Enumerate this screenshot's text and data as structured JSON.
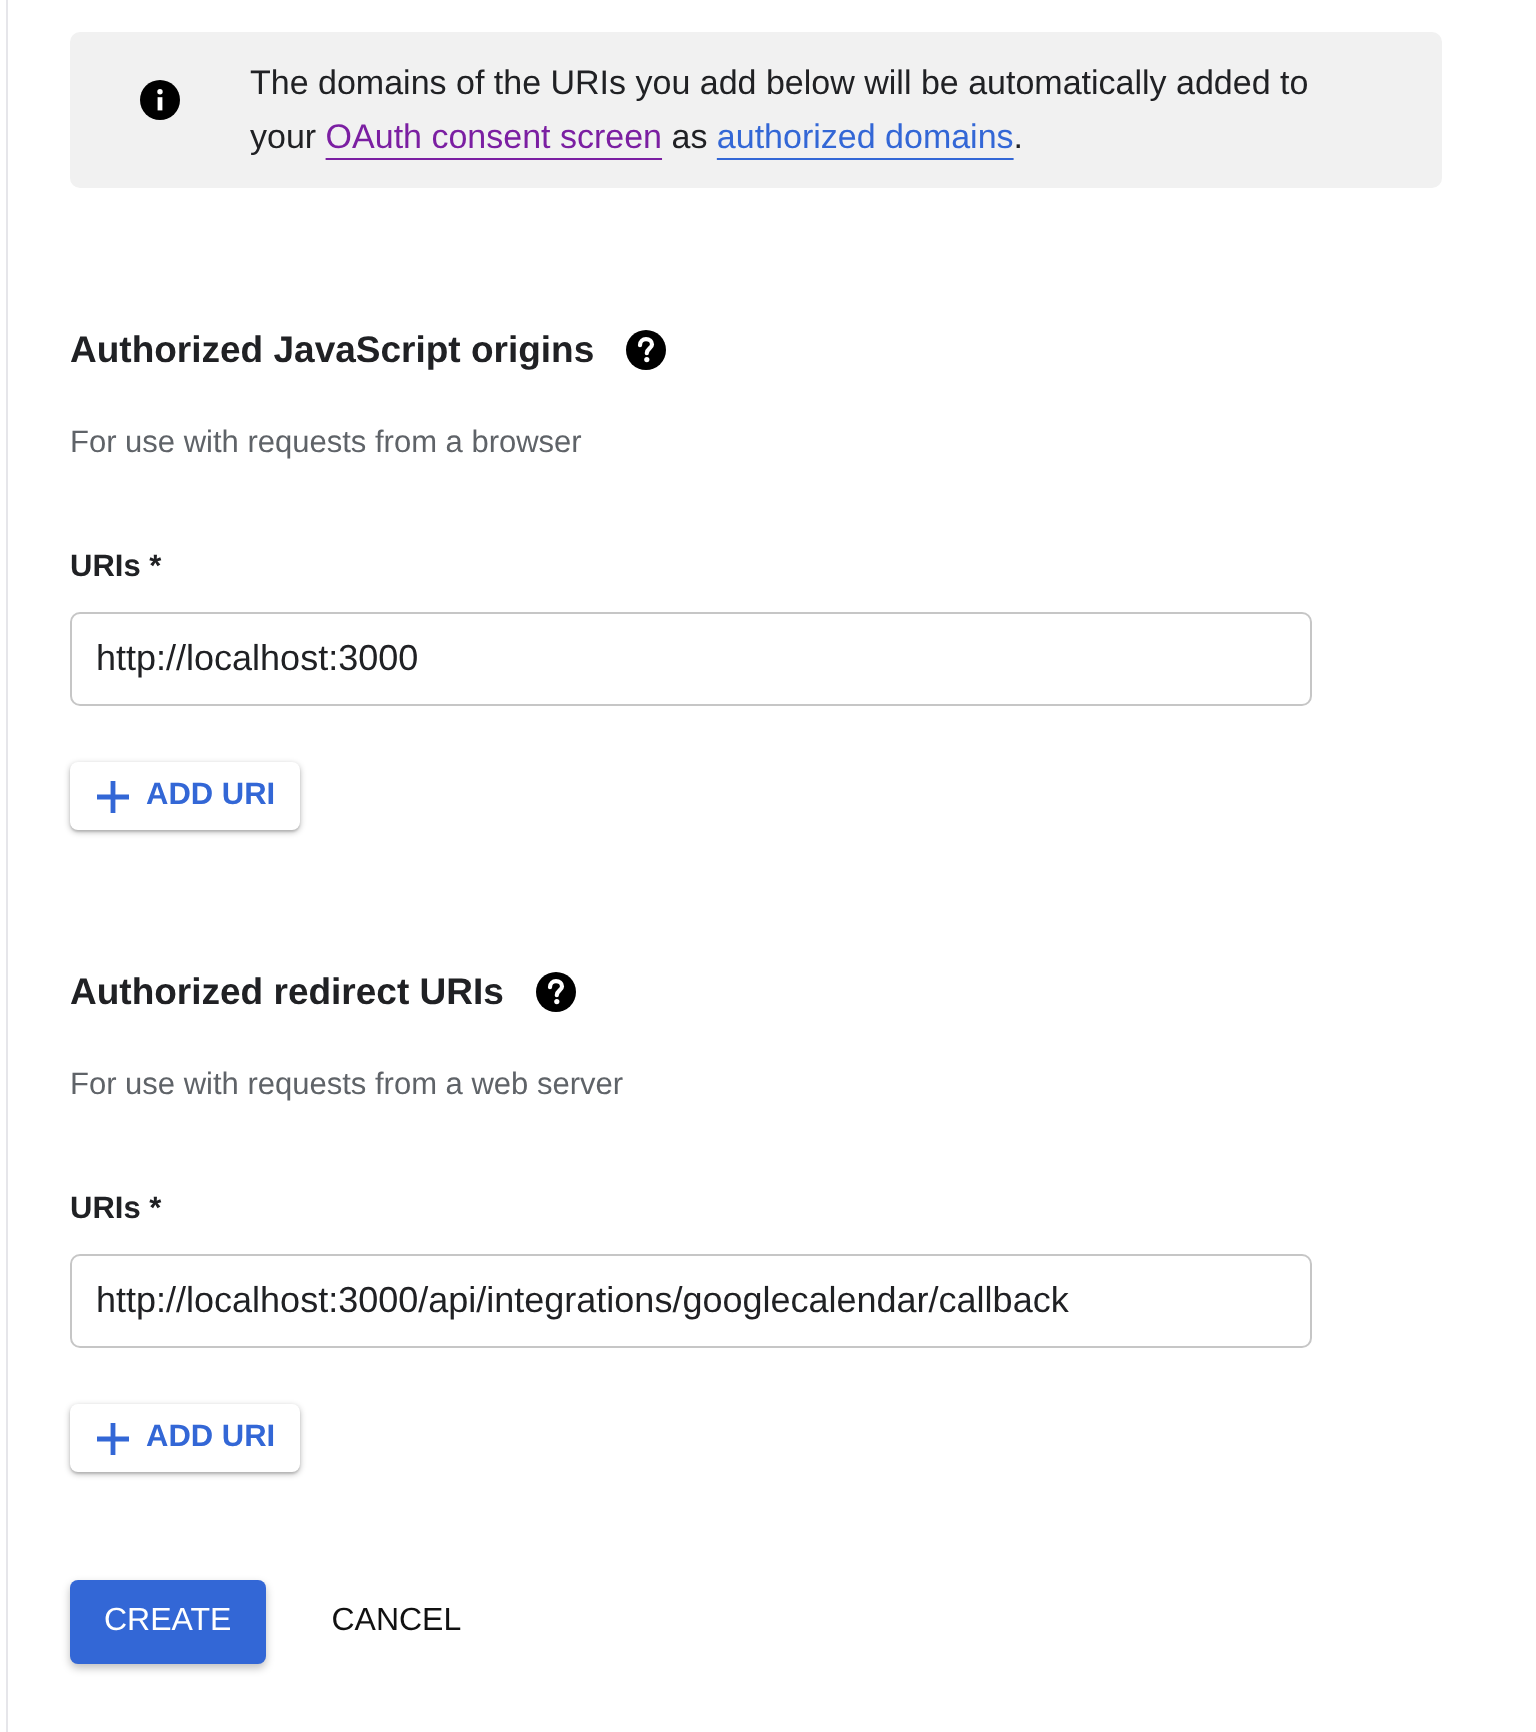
{
  "banner": {
    "parts": [
      {
        "kind": "text",
        "text": "The domains of the URIs you add below will be automatically added to your "
      },
      {
        "kind": "link",
        "text": "OAuth consent screen",
        "visited": true
      },
      {
        "kind": "text",
        "text": " as "
      },
      {
        "kind": "link",
        "text": "authorized domains",
        "visited": false
      },
      {
        "kind": "text",
        "text": "."
      }
    ]
  },
  "sections": [
    {
      "title": "Authorized JavaScript origins",
      "subtitle": "For use with requests from a browser",
      "field_label": "URIs *",
      "uris": [
        "http://localhost:3000"
      ],
      "add_button": "ADD URI"
    },
    {
      "title": "Authorized redirect URIs",
      "subtitle": "For use with requests from a web server",
      "field_label": "URIs *",
      "uris": [
        "http://localhost:3000/api/integrations/googlecalendar/callback"
      ],
      "add_button": "ADD URI"
    }
  ],
  "actions": [
    {
      "kind": "primary",
      "label": "CREATE"
    },
    {
      "kind": "text",
      "label": "CANCEL"
    }
  ]
}
